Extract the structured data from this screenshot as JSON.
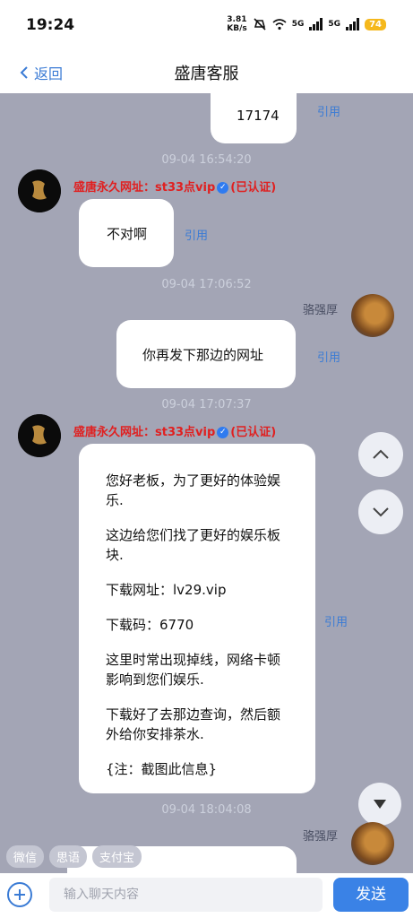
{
  "status_bar": {
    "time": "19:24",
    "net_speed_value": "3.81",
    "net_speed_unit": "KB/s",
    "sim1_label": "5G",
    "sim2_label": "5G",
    "battery": "74"
  },
  "nav": {
    "back_label": "返回",
    "title": "盛唐客服"
  },
  "messages": {
    "m1_text": "17174",
    "quote_label": "引用",
    "ts1": "09-04 16:54:20",
    "sender_name": "盛唐永久网址：st33点vip",
    "verified_label": "(已认证)",
    "m2_text": "不对啊",
    "ts2": "09-04 17:06:52",
    "my_name": "骆强厚",
    "m3_text": "你再发下那边的网址",
    "ts3": "09-04 17:07:37",
    "m4_lines": [
      "您好老板，为了更好的体验娱乐.",
      "这边给您们找了更好的娱乐板块.",
      "下载网址：lv29.vip",
      "下载码：6770",
      "这里时常出现掉线，网络卡顿影响到您们娱乐.",
      "下载好了去那边查询，然后额外给你安排茶水.",
      "{注：截图此信息}"
    ],
    "ts4": "09-04 18:04:08",
    "my_name_2": "骆强厚"
  },
  "quick_tabs": [
    "微信",
    "思语",
    "支付宝"
  ],
  "input": {
    "placeholder": "输入聊天内容",
    "send_label": "发送"
  },
  "colors": {
    "chat_bg": "#a3a5b5",
    "accent": "#3a7bd5",
    "sender_red": "#e02020",
    "battery": "#f5b81c"
  },
  "icons": [
    "back-chevron-icon",
    "verified-icon",
    "chevron-up-icon",
    "chevron-down-icon",
    "arrow-down-icon",
    "plus-icon",
    "mute-icon",
    "wifi-icon",
    "signal-icon"
  ]
}
